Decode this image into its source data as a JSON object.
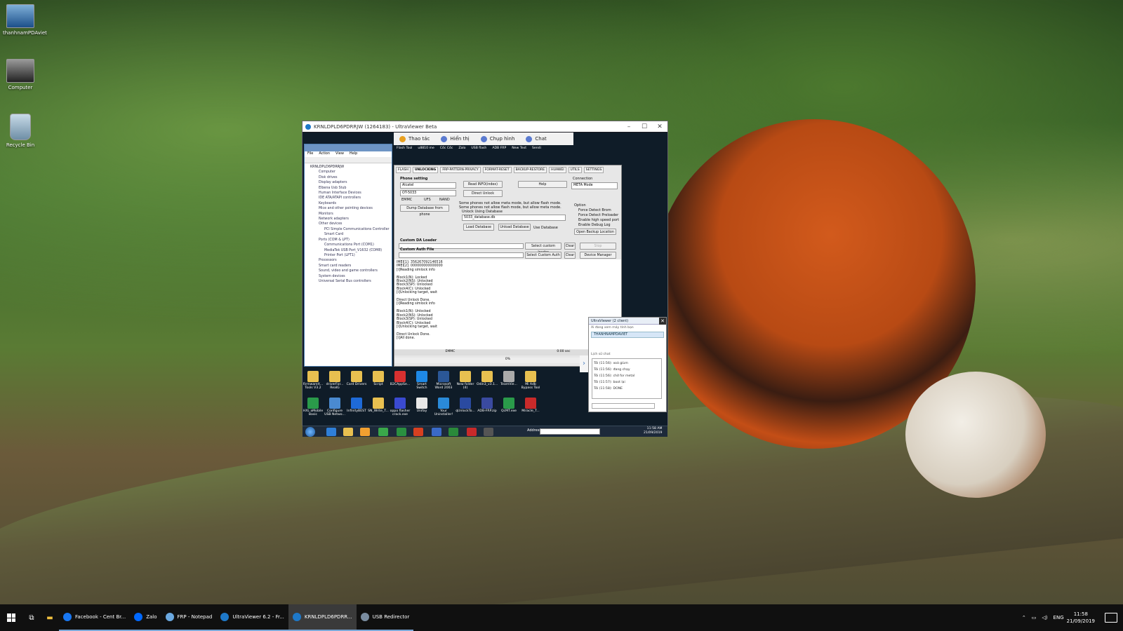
{
  "desktop": {
    "icons": [
      {
        "label": "thanhnamPDAviet"
      },
      {
        "label": "Computer"
      },
      {
        "label": "Recycle Bin"
      }
    ]
  },
  "ultraviewer": {
    "title": "KRNLDPLD6PDRRJW (1264183) - UltraViewer Beta",
    "toolbar": [
      "Thao tác",
      "Hiển thị",
      "Chụp hình",
      "Chat"
    ],
    "remote_apps_row": [
      "Flash Tool",
      "u8810 me",
      "Cốc Cốc",
      "Zalo",
      "USB flash",
      "ADB FRP",
      "New Text",
      "Sendi"
    ]
  },
  "device_manager": {
    "menu": [
      "File",
      "Action",
      "View",
      "Help"
    ],
    "root": "KRNLDPLD6PDRRJW",
    "items": [
      "Computer",
      "Disk drives",
      "Display adapters",
      "Elbena Usb Stub",
      "Human Interface Devices",
      "IDE ATA/ATAPI controllers",
      "Keyboards",
      "Mice and other pointing devices",
      "Monitors",
      "Network adapters",
      "Other devices"
    ],
    "other_devices": [
      "PCI Simple Communications Controller",
      "Smart Card"
    ],
    "ports_label": "Ports (COM & LPT)",
    "ports": [
      "Communications Port (COM1)",
      "MediaTek USB Port_V1632 (COM8)",
      "Printer Port (LPT1)"
    ],
    "tail": [
      "Processors",
      "Smart card readers",
      "Sound, video and game controllers",
      "System devices",
      "Universal Serial Bus controllers"
    ]
  },
  "mrt": {
    "tabs": [
      "FLASH",
      "UNLOCKING",
      "FRP-PATTERN-PRIVACY",
      "FORMAT-RESET",
      "BACKUP-RESTORE",
      "HUAWEI",
      "UTILS",
      "SETTINGS"
    ],
    "phone_setting_label": "Phone setting",
    "brand": "Alcatel",
    "model": "OT-5033",
    "storage": [
      "EMMC",
      "UFS",
      "NAND"
    ],
    "btn_read_info": "Read INFO(index)",
    "btn_help": "Help",
    "btn_direct_unlock": "Direct Unlock",
    "connection_label": "Connection",
    "connection_value": "META Mode",
    "note1": "Some phones not allow meta mode, but allow flash mode.",
    "note2": "Some phones not allow flash mode, but allow meta mode.",
    "unlock_db_label": "Unlock Using Database",
    "db_file": "5033_database.db",
    "btn_dump": "Dump Database from phone",
    "btn_load_db": "Load Database",
    "btn_unload_db": "Unload Database",
    "use_db": "Use Database",
    "option_label": "Option",
    "options": [
      "Force Detect Brom",
      "Force Detect Preloader",
      "Enable high speed port",
      "Enable Debug Log"
    ],
    "btn_open_backup": "Open Backup Location",
    "custom_da_label": "Custom DA Loader",
    "custom_auth_label": "Custom Auth File",
    "btn_select_loader": "Select custom loader",
    "btn_select_auth": "Select Custom Auth",
    "btn_clear": "Clear",
    "btn_stop": "Stop",
    "btn_device_manager": "Device Manager",
    "log": "IMEI[1]: 356267092146516\nIMEI[2]: 000000000000000\n[i]Reading simlock info\n\nBlock1(N): Locked\nBlock2(NS): Unlocked\nBlock3(SP): Unlocked\nBlock4(C): Unlocked\n[i]Unlocking target, wait\n\nDirect Unlock Done.\n[i]Reading simlock info\n\nBlock1(N): Unlocked\nBlock2(NS): Unlocked\nBlock3(SP): Unlocked\nBlock4(C): Unlocked\n[i]Unlocking target, wait\n\nDirect Unlock Done.\n[i]All done.",
    "status_storage": "EMMC",
    "status_time": "0:00 sec",
    "progress": "0%"
  },
  "remote_desktop_icons": [
    [
      "FirmwareX...",
      "Tools V3.2"
    ],
    [
      "driverFor...",
      "RealG"
    ],
    [
      "Card Drivers",
      ""
    ],
    [
      "Script",
      ""
    ],
    [
      "B2CAppSe...",
      ""
    ],
    [
      "Smart Switch",
      ""
    ],
    [
      "Microsoft",
      "Word 2003"
    ],
    [
      "New folder",
      "(4)"
    ],
    [
      "Odin3_v3.1...",
      ""
    ],
    [
      "TeamVie...",
      ""
    ],
    [
      "Mi Adb",
      "Bypass Tool"
    ],
    [
      "HXL aMobile",
      "Basic"
    ],
    [
      "Configure",
      "USB Netwo..."
    ],
    [
      "InfinityBEST",
      ""
    ],
    [
      "SN_Write_T...",
      ""
    ],
    [
      "oppo flasher",
      "crack.exe"
    ],
    [
      "Unifay",
      ""
    ],
    [
      "Your",
      "Uninstaller!"
    ],
    [
      "qUnlockTo...",
      ""
    ],
    [
      "ADB-FRP.zip",
      ""
    ],
    [
      "QcMT.exe",
      ""
    ],
    [
      "Miracle_T...",
      ""
    ]
  ],
  "remote_taskbar": {
    "address_label": "Address",
    "time": "11:58 AM",
    "date": "21/09/2019"
  },
  "chat": {
    "title": "UltraViewer (2 client)",
    "subtitle": "Ai đang xem máy tính bạn",
    "user": "THANHNAMPDAVIET",
    "history_label": "Lịch sử chat",
    "messages": [
      {
        "who": "Tôi",
        "time": "(11:56)",
        "text": "xoá giùm"
      },
      {
        "who": "Tôi",
        "time": "(11:56)",
        "text": "đang chạy"
      },
      {
        "who": "Tôi",
        "time": "(11:56)",
        "text": "chờ for metal"
      },
      {
        "who": "Tôi",
        "time": "(11:57)",
        "text": "boot lại"
      },
      {
        "who": "Tôi",
        "time": "(11:58)",
        "text": "DONE"
      }
    ]
  },
  "taskbar": {
    "apps": [
      {
        "label": "Facebook - Cent Br...",
        "color": "#1877f2"
      },
      {
        "label": "Zalo",
        "color": "#0068ff"
      },
      {
        "label": "FRP - Notepad",
        "color": "#6aa8e0"
      },
      {
        "label": "UltraViewer 6.2 - Fr...",
        "color": "#1e78c8"
      },
      {
        "label": "KRNLDPLD6PDRR...",
        "color": "#1e78c8"
      },
      {
        "label": "USB Redirector",
        "color": "#7a8ca0"
      }
    ],
    "lang": "ENG",
    "time": "11:58",
    "date": "21/09/2019"
  }
}
